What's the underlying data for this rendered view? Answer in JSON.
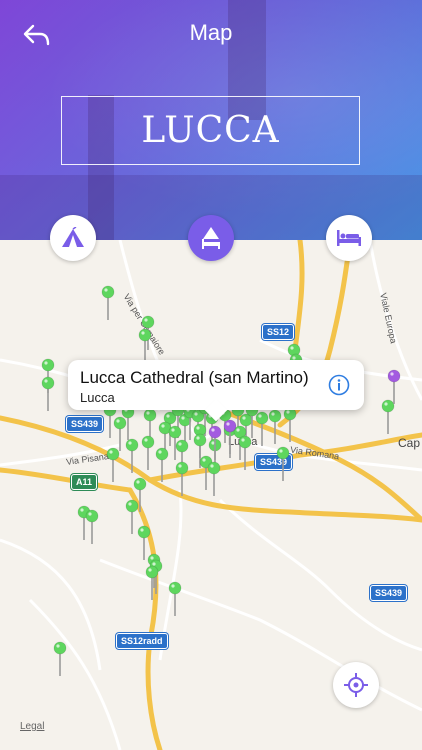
{
  "header": {
    "title": "Map",
    "city": "LUCCA",
    "back_icon": "back-arrow-icon"
  },
  "categories": [
    {
      "name": "attractions",
      "icon": "tent-icon",
      "active": false
    },
    {
      "name": "camping-hotels",
      "icon": "camping-bed-icon",
      "active": true
    },
    {
      "name": "hotels",
      "icon": "bed-icon",
      "active": false
    }
  ],
  "callout": {
    "title": "Lucca Cathedral (san Martino)",
    "subtitle": "Lucca"
  },
  "map": {
    "road_shields": [
      "SS12",
      "SS439",
      "A11",
      "SS439",
      "SS439",
      "SS12radd"
    ],
    "road_labels": [
      "Via per Camaiore",
      "Viale Europa",
      "Via Pisana",
      "Via Romana"
    ],
    "place_labels": [
      "Lucca",
      "Cap"
    ],
    "legal": "Legal"
  },
  "colors": {
    "pin_green": "#5ed65e",
    "pin_purple": "#a35be0",
    "accent": "#7a5de8"
  }
}
